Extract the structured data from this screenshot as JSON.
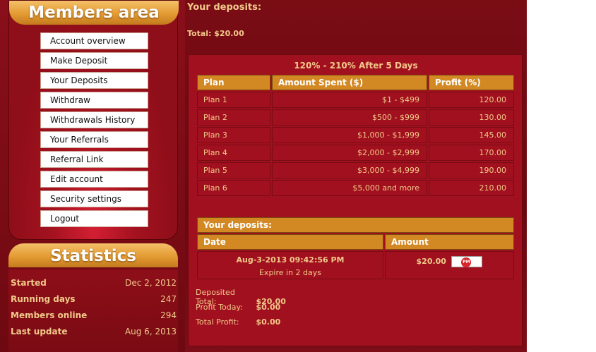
{
  "members": {
    "title": "Members area",
    "menu": [
      {
        "label": "Account overview"
      },
      {
        "label": "Make Deposit"
      },
      {
        "label": "Your Deposits"
      },
      {
        "label": "Withdraw"
      },
      {
        "label": "Withdrawals History"
      },
      {
        "label": "Your Referrals"
      },
      {
        "label": "Referral Link"
      },
      {
        "label": "Edit account"
      },
      {
        "label": "Security settings"
      },
      {
        "label": "Logout"
      }
    ]
  },
  "statistics": {
    "title": "Statistics",
    "rows": [
      {
        "label": "Started",
        "value": "Dec 2, 2012"
      },
      {
        "label": "Running days",
        "value": "247"
      },
      {
        "label": "Members online",
        "value": "294"
      },
      {
        "label": "Last update",
        "value": "Aug 6, 2013"
      }
    ]
  },
  "main": {
    "title": "Your deposits:",
    "total": "Total: $20.00",
    "plan_title": "120% - 210% After 5 Days",
    "plan_headers": [
      "Plan",
      "Amount Spent ($)",
      "Profit (%)"
    ],
    "plans": [
      {
        "name": "Plan 1",
        "amount": "$1 - $499",
        "profit": "120.00"
      },
      {
        "name": "Plan 2",
        "amount": "$500 - $999",
        "profit": "130.00"
      },
      {
        "name": "Plan 3",
        "amount": "$1,000 - $1,999",
        "profit": "145.00"
      },
      {
        "name": "Plan 4",
        "amount": "$2,000 - $2,999",
        "profit": "170.00"
      },
      {
        "name": "Plan 5",
        "amount": "$3,000 - $4,999",
        "profit": "190.00"
      },
      {
        "name": "Plan 6",
        "amount": "$5,000 and more",
        "profit": "210.00"
      }
    ],
    "deposits_title": "Your deposits:",
    "deposit_headers": [
      "Date",
      "Amount"
    ],
    "deposit": {
      "date": "Aug-3-2013 09:42:56 PM",
      "expire": "Expire in 2 days",
      "amount": "$20.00",
      "badge": "PM"
    },
    "summary": [
      {
        "label": "Deposited Total:",
        "value": "$20.00"
      },
      {
        "label": "Profit Today:",
        "value": "$0.00"
      },
      {
        "label": "Total Profit:",
        "value": "$0.00"
      }
    ]
  },
  "colors": {
    "accent": "#d28924",
    "background": "#7a0c14",
    "panel": "#a1101e",
    "text": "#f2c98a"
  }
}
